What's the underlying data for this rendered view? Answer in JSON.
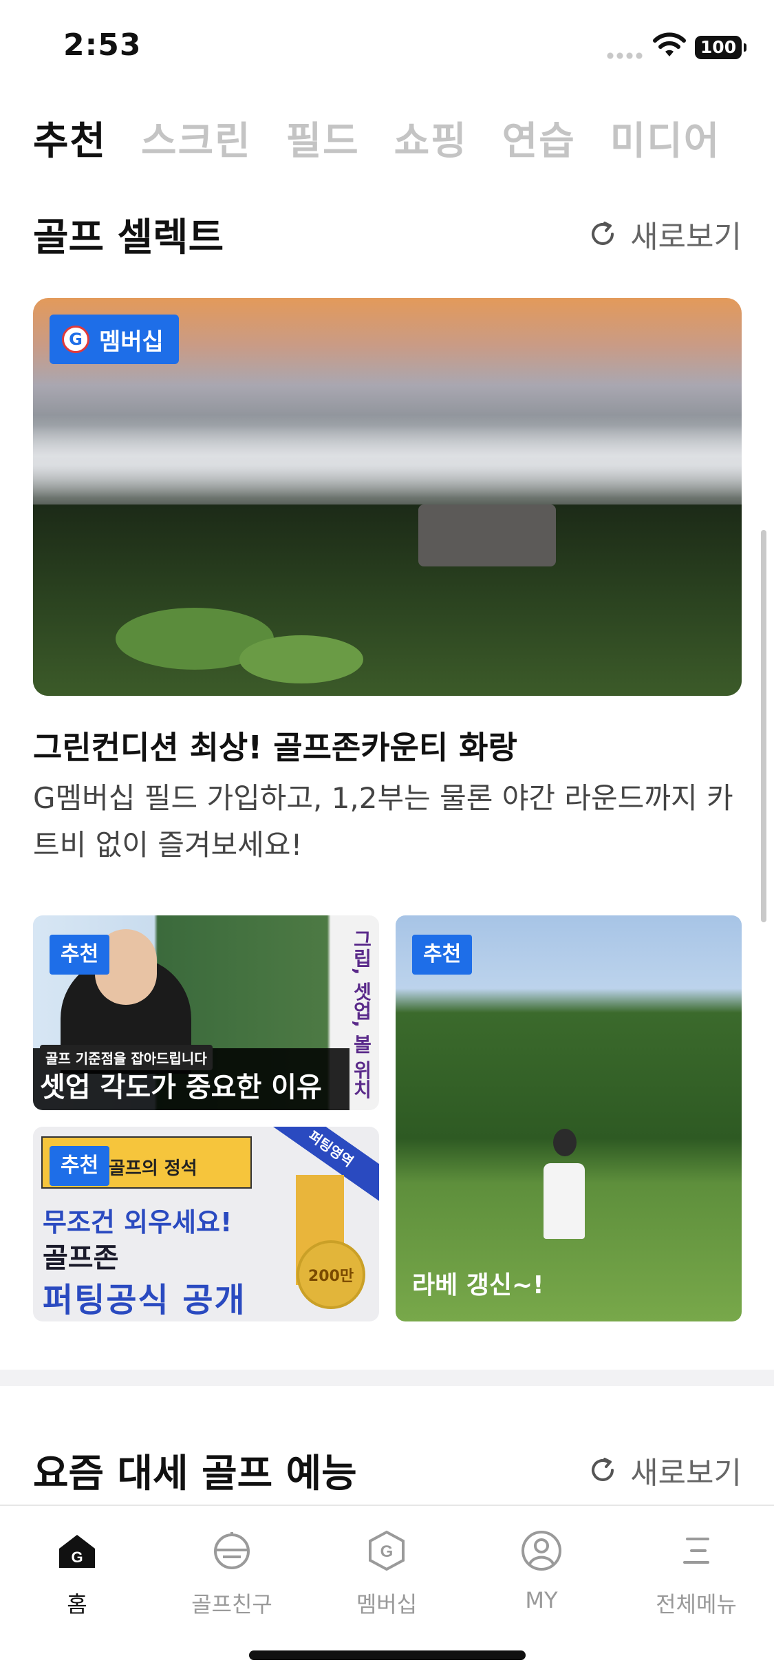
{
  "status_bar": {
    "time": "2:53",
    "battery": "100"
  },
  "tabs": [
    {
      "label": "추천",
      "active": true
    },
    {
      "label": "스크린",
      "active": false
    },
    {
      "label": "필드",
      "active": false
    },
    {
      "label": "쇼핑",
      "active": false
    },
    {
      "label": "연습",
      "active": false
    },
    {
      "label": "미디어",
      "active": false
    }
  ],
  "golf_select": {
    "title": "골프 셀렉트",
    "refresh_label": "새로보기",
    "hero": {
      "badge": "멤버십",
      "badge_logo": "G",
      "title": "그린컨디션 최상! 골프존카운티 화랑",
      "description": "G멤버십 필드 가입하고, 1,2부는 물론 야간 라운드까지 카트비 없이 즐겨보세요!"
    },
    "tiles": [
      {
        "tag": "추천",
        "subtitle": "골프 기준점을 잡아드립니다",
        "headline": "셋업 각도가 중요한 이유",
        "side_text": "그립, 셋업, 볼 위치"
      },
      {
        "tag": "추천",
        "label": "골프의 정석",
        "ribbon": "퍼팅영역",
        "line1": "무조건 외우세요!",
        "line2": "골프존",
        "line3": "퍼팅공식 공개",
        "coin": "200만"
      },
      {
        "tag": "추천",
        "caption": "라베 갱신~!"
      }
    ]
  },
  "trending": {
    "title": "요즘 대세 골프 예능",
    "refresh_label": "새로보기"
  },
  "bottom_nav": [
    {
      "label": "홈",
      "icon": "home-icon",
      "active": true
    },
    {
      "label": "골프친구",
      "icon": "golf-friend-icon",
      "active": false
    },
    {
      "label": "멤버십",
      "icon": "membership-icon",
      "active": false
    },
    {
      "label": "MY",
      "icon": "profile-icon",
      "active": false
    },
    {
      "label": "전체메뉴",
      "icon": "menu-icon",
      "active": false
    }
  ],
  "colors": {
    "accent": "#1e6ee8",
    "text": "#111111",
    "muted": "#9a9a9a"
  }
}
